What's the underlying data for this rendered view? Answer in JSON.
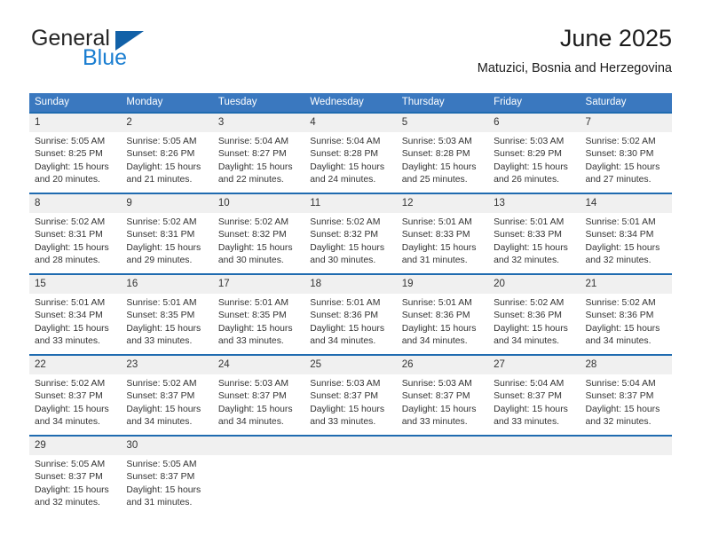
{
  "brand": {
    "name_top": "General",
    "name_bottom": "Blue",
    "accent_dark": "#1261a8",
    "accent_light": "#1a7ed1"
  },
  "header": {
    "title": "June 2025",
    "subtitle": "Matuzici, Bosnia and Herzegovina"
  },
  "theme": {
    "header_bg": "#3a78bf",
    "row_rule": "#1f6bb0",
    "daynum_bg": "#f0f0f0",
    "text": "#333333"
  },
  "calendar": {
    "weekday_headers": [
      "Sunday",
      "Monday",
      "Tuesday",
      "Wednesday",
      "Thursday",
      "Friday",
      "Saturday"
    ],
    "weeks": [
      [
        {
          "day": "1",
          "sunrise": "Sunrise: 5:05 AM",
          "sunset": "Sunset: 8:25 PM",
          "daylight": "Daylight: 15 hours and 20 minutes."
        },
        {
          "day": "2",
          "sunrise": "Sunrise: 5:05 AM",
          "sunset": "Sunset: 8:26 PM",
          "daylight": "Daylight: 15 hours and 21 minutes."
        },
        {
          "day": "3",
          "sunrise": "Sunrise: 5:04 AM",
          "sunset": "Sunset: 8:27 PM",
          "daylight": "Daylight: 15 hours and 22 minutes."
        },
        {
          "day": "4",
          "sunrise": "Sunrise: 5:04 AM",
          "sunset": "Sunset: 8:28 PM",
          "daylight": "Daylight: 15 hours and 24 minutes."
        },
        {
          "day": "5",
          "sunrise": "Sunrise: 5:03 AM",
          "sunset": "Sunset: 8:28 PM",
          "daylight": "Daylight: 15 hours and 25 minutes."
        },
        {
          "day": "6",
          "sunrise": "Sunrise: 5:03 AM",
          "sunset": "Sunset: 8:29 PM",
          "daylight": "Daylight: 15 hours and 26 minutes."
        },
        {
          "day": "7",
          "sunrise": "Sunrise: 5:02 AM",
          "sunset": "Sunset: 8:30 PM",
          "daylight": "Daylight: 15 hours and 27 minutes."
        }
      ],
      [
        {
          "day": "8",
          "sunrise": "Sunrise: 5:02 AM",
          "sunset": "Sunset: 8:31 PM",
          "daylight": "Daylight: 15 hours and 28 minutes."
        },
        {
          "day": "9",
          "sunrise": "Sunrise: 5:02 AM",
          "sunset": "Sunset: 8:31 PM",
          "daylight": "Daylight: 15 hours and 29 minutes."
        },
        {
          "day": "10",
          "sunrise": "Sunrise: 5:02 AM",
          "sunset": "Sunset: 8:32 PM",
          "daylight": "Daylight: 15 hours and 30 minutes."
        },
        {
          "day": "11",
          "sunrise": "Sunrise: 5:02 AM",
          "sunset": "Sunset: 8:32 PM",
          "daylight": "Daylight: 15 hours and 30 minutes."
        },
        {
          "day": "12",
          "sunrise": "Sunrise: 5:01 AM",
          "sunset": "Sunset: 8:33 PM",
          "daylight": "Daylight: 15 hours and 31 minutes."
        },
        {
          "day": "13",
          "sunrise": "Sunrise: 5:01 AM",
          "sunset": "Sunset: 8:33 PM",
          "daylight": "Daylight: 15 hours and 32 minutes."
        },
        {
          "day": "14",
          "sunrise": "Sunrise: 5:01 AM",
          "sunset": "Sunset: 8:34 PM",
          "daylight": "Daylight: 15 hours and 32 minutes."
        }
      ],
      [
        {
          "day": "15",
          "sunrise": "Sunrise: 5:01 AM",
          "sunset": "Sunset: 8:34 PM",
          "daylight": "Daylight: 15 hours and 33 minutes."
        },
        {
          "day": "16",
          "sunrise": "Sunrise: 5:01 AM",
          "sunset": "Sunset: 8:35 PM",
          "daylight": "Daylight: 15 hours and 33 minutes."
        },
        {
          "day": "17",
          "sunrise": "Sunrise: 5:01 AM",
          "sunset": "Sunset: 8:35 PM",
          "daylight": "Daylight: 15 hours and 33 minutes."
        },
        {
          "day": "18",
          "sunrise": "Sunrise: 5:01 AM",
          "sunset": "Sunset: 8:36 PM",
          "daylight": "Daylight: 15 hours and 34 minutes."
        },
        {
          "day": "19",
          "sunrise": "Sunrise: 5:01 AM",
          "sunset": "Sunset: 8:36 PM",
          "daylight": "Daylight: 15 hours and 34 minutes."
        },
        {
          "day": "20",
          "sunrise": "Sunrise: 5:02 AM",
          "sunset": "Sunset: 8:36 PM",
          "daylight": "Daylight: 15 hours and 34 minutes."
        },
        {
          "day": "21",
          "sunrise": "Sunrise: 5:02 AM",
          "sunset": "Sunset: 8:36 PM",
          "daylight": "Daylight: 15 hours and 34 minutes."
        }
      ],
      [
        {
          "day": "22",
          "sunrise": "Sunrise: 5:02 AM",
          "sunset": "Sunset: 8:37 PM",
          "daylight": "Daylight: 15 hours and 34 minutes."
        },
        {
          "day": "23",
          "sunrise": "Sunrise: 5:02 AM",
          "sunset": "Sunset: 8:37 PM",
          "daylight": "Daylight: 15 hours and 34 minutes."
        },
        {
          "day": "24",
          "sunrise": "Sunrise: 5:03 AM",
          "sunset": "Sunset: 8:37 PM",
          "daylight": "Daylight: 15 hours and 34 minutes."
        },
        {
          "day": "25",
          "sunrise": "Sunrise: 5:03 AM",
          "sunset": "Sunset: 8:37 PM",
          "daylight": "Daylight: 15 hours and 33 minutes."
        },
        {
          "day": "26",
          "sunrise": "Sunrise: 5:03 AM",
          "sunset": "Sunset: 8:37 PM",
          "daylight": "Daylight: 15 hours and 33 minutes."
        },
        {
          "day": "27",
          "sunrise": "Sunrise: 5:04 AM",
          "sunset": "Sunset: 8:37 PM",
          "daylight": "Daylight: 15 hours and 33 minutes."
        },
        {
          "day": "28",
          "sunrise": "Sunrise: 5:04 AM",
          "sunset": "Sunset: 8:37 PM",
          "daylight": "Daylight: 15 hours and 32 minutes."
        }
      ],
      [
        {
          "day": "29",
          "sunrise": "Sunrise: 5:05 AM",
          "sunset": "Sunset: 8:37 PM",
          "daylight": "Daylight: 15 hours and 32 minutes."
        },
        {
          "day": "30",
          "sunrise": "Sunrise: 5:05 AM",
          "sunset": "Sunset: 8:37 PM",
          "daylight": "Daylight: 15 hours and 31 minutes."
        },
        {
          "day": "",
          "sunrise": "",
          "sunset": "",
          "daylight": ""
        },
        {
          "day": "",
          "sunrise": "",
          "sunset": "",
          "daylight": ""
        },
        {
          "day": "",
          "sunrise": "",
          "sunset": "",
          "daylight": ""
        },
        {
          "day": "",
          "sunrise": "",
          "sunset": "",
          "daylight": ""
        },
        {
          "day": "",
          "sunrise": "",
          "sunset": "",
          "daylight": ""
        }
      ]
    ]
  }
}
